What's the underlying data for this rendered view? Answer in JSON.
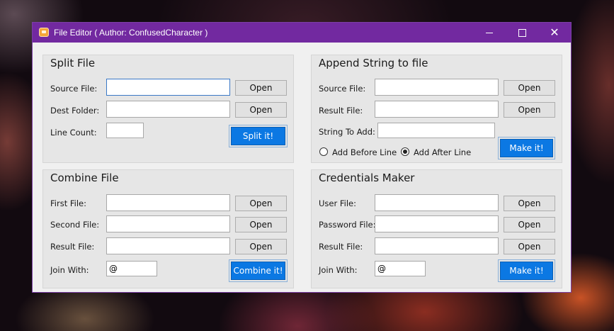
{
  "window": {
    "title": "File Editor ( Author: ConfusedCharacter )",
    "controls": {
      "minimize": "minimize",
      "maximize": "maximize",
      "close": "✕"
    }
  },
  "split_file": {
    "title": "Split File",
    "source_label": "Source File:",
    "source_value": "",
    "dest_label": "Dest Folder:",
    "dest_value": "",
    "line_count_label": "Line Count:",
    "line_count_value": "",
    "open_label": "Open",
    "action_label": "Split it!"
  },
  "append_string": {
    "title": "Append String to file",
    "source_label": "Source File:",
    "source_value": "",
    "result_label": "Result File:",
    "result_value": "",
    "string_label": "String To Add:",
    "string_value": "",
    "open_label": "Open",
    "radio_before_label": "Add Before Line",
    "radio_after_label": "Add After Line",
    "selected_position": "Add After Line",
    "action_label": "Make it!"
  },
  "combine_file": {
    "title": "Combine File",
    "first_label": "First File:",
    "first_value": "",
    "second_label": "Second File:",
    "second_value": "",
    "result_label": "Result File:",
    "result_value": "",
    "join_label": "Join With:",
    "join_value": "@",
    "open_label": "Open",
    "action_label": "Combine it!"
  },
  "credentials_maker": {
    "title": "Credentials Maker",
    "user_label": "User File:",
    "user_value": "",
    "password_label": "Password File:",
    "password_value": "",
    "result_label": "Result File:",
    "result_value": "",
    "join_label": "Join With:",
    "join_value": "@",
    "open_label": "Open",
    "action_label": "Make it!"
  },
  "colors": {
    "titlebar": "#7229a0",
    "accent_button": "#0b78e3",
    "panel_bg": "#e6e6e6",
    "window_bg": "#f0f0f0"
  }
}
